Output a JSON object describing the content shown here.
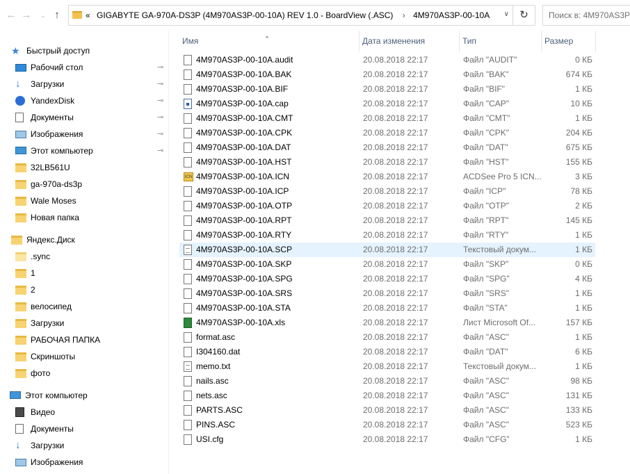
{
  "address": {
    "prefix": "«",
    "crumb1": "GIGABYTE GA-970A-DS3P (4M970AS3P-00-10A) REV 1.0 - BoardView (.ASC)",
    "crumb2": "4M970AS3P-00-10A",
    "search_placeholder": "Поиск в: 4M970AS3P-"
  },
  "nav": {
    "quick_access": "Быстрый доступ",
    "quick_items": [
      "Рабочий стол",
      "Загрузки",
      "YandexDisk",
      "Документы",
      "Изображения",
      "Этот компьютер",
      "32LB561U",
      "ga-970a-ds3p",
      "Wale Moses",
      "Новая папка"
    ],
    "yandex": "Яндекс.Диск",
    "yandex_items": [
      ".sync",
      "1",
      "2",
      "велосипед",
      "Загрузки",
      "РАБОЧАЯ ПАПКА",
      "Скриншоты",
      "фото"
    ],
    "this_pc": "Этот компьютер",
    "pc_items": [
      "Видео",
      "Документы",
      "Загрузки",
      "Изображения"
    ]
  },
  "columns": {
    "name": "Имя",
    "date": "Дата изменения",
    "type": "Тип",
    "size": "Размер"
  },
  "files": [
    {
      "name": "4M970AS3P-00-10A.audit",
      "date": "20.08.2018 22:17",
      "type": "Файл \"AUDIT\"",
      "size": "0 КБ",
      "icon": "file"
    },
    {
      "name": "4M970AS3P-00-10A.BAK",
      "date": "20.08.2018 22:17",
      "type": "Файл \"BAK\"",
      "size": "674 КБ",
      "icon": "file"
    },
    {
      "name": "4M970AS3P-00-10A.BIF",
      "date": "20.08.2018 22:17",
      "type": "Файл \"BIF\"",
      "size": "1 КБ",
      "icon": "file"
    },
    {
      "name": "4M970AS3P-00-10A.cap",
      "date": "20.08.2018 22:17",
      "type": "Файл \"CAP\"",
      "size": "10 КБ",
      "icon": "cap"
    },
    {
      "name": "4M970AS3P-00-10A.CMT",
      "date": "20.08.2018 22:17",
      "type": "Файл \"CMT\"",
      "size": "1 КБ",
      "icon": "file"
    },
    {
      "name": "4M970AS3P-00-10A.CPK",
      "date": "20.08.2018 22:17",
      "type": "Файл \"CPK\"",
      "size": "204 КБ",
      "icon": "file"
    },
    {
      "name": "4M970AS3P-00-10A.DAT",
      "date": "20.08.2018 22:17",
      "type": "Файл \"DAT\"",
      "size": "675 КБ",
      "icon": "file"
    },
    {
      "name": "4M970AS3P-00-10A.HST",
      "date": "20.08.2018 22:17",
      "type": "Файл \"HST\"",
      "size": "155 КБ",
      "icon": "file"
    },
    {
      "name": "4M970AS3P-00-10A.ICN",
      "date": "20.08.2018 22:17",
      "type": "ACDSee Pro 5 ICN...",
      "size": "3 КБ",
      "icon": "icn"
    },
    {
      "name": "4M970AS3P-00-10A.ICP",
      "date": "20.08.2018 22:17",
      "type": "Файл \"ICP\"",
      "size": "78 КБ",
      "icon": "file"
    },
    {
      "name": "4M970AS3P-00-10A.OTP",
      "date": "20.08.2018 22:17",
      "type": "Файл \"OTP\"",
      "size": "2 КБ",
      "icon": "file"
    },
    {
      "name": "4M970AS3P-00-10A.RPT",
      "date": "20.08.2018 22:17",
      "type": "Файл \"RPT\"",
      "size": "145 КБ",
      "icon": "file"
    },
    {
      "name": "4M970AS3P-00-10A.RTY",
      "date": "20.08.2018 22:17",
      "type": "Файл \"RTY\"",
      "size": "1 КБ",
      "icon": "file"
    },
    {
      "name": "4M970AS3P-00-10A.SCP",
      "date": "20.08.2018 22:17",
      "type": "Текстовый докум...",
      "size": "1 КБ",
      "icon": "txt",
      "selected": true
    },
    {
      "name": "4M970AS3P-00-10A.SKP",
      "date": "20.08.2018 22:17",
      "type": "Файл \"SKP\"",
      "size": "0 КБ",
      "icon": "file"
    },
    {
      "name": "4M970AS3P-00-10A.SPG",
      "date": "20.08.2018 22:17",
      "type": "Файл \"SPG\"",
      "size": "4 КБ",
      "icon": "file"
    },
    {
      "name": "4M970AS3P-00-10A.SRS",
      "date": "20.08.2018 22:17",
      "type": "Файл \"SRS\"",
      "size": "1 КБ",
      "icon": "file"
    },
    {
      "name": "4M970AS3P-00-10A.STA",
      "date": "20.08.2018 22:17",
      "type": "Файл \"STA\"",
      "size": "1 КБ",
      "icon": "file"
    },
    {
      "name": "4M970AS3P-00-10A.xls",
      "date": "20.08.2018 22:17",
      "type": "Лист Microsoft Of...",
      "size": "157 КБ",
      "icon": "xls"
    },
    {
      "name": "format.asc",
      "date": "20.08.2018 22:17",
      "type": "Файл \"ASC\"",
      "size": "1 КБ",
      "icon": "file"
    },
    {
      "name": "I304160.dat",
      "date": "20.08.2018 22:17",
      "type": "Файл \"DAT\"",
      "size": "6 КБ",
      "icon": "file"
    },
    {
      "name": "memo.txt",
      "date": "20.08.2018 22:17",
      "type": "Текстовый докум...",
      "size": "1 КБ",
      "icon": "txt"
    },
    {
      "name": "nails.asc",
      "date": "20.08.2018 22:17",
      "type": "Файл \"ASC\"",
      "size": "98 КБ",
      "icon": "file"
    },
    {
      "name": "nets.asc",
      "date": "20.08.2018 22:17",
      "type": "Файл \"ASC\"",
      "size": "131 КБ",
      "icon": "file"
    },
    {
      "name": "PARTS.ASC",
      "date": "20.08.2018 22:17",
      "type": "Файл \"ASC\"",
      "size": "133 КБ",
      "icon": "file"
    },
    {
      "name": "PINS.ASC",
      "date": "20.08.2018 22:17",
      "type": "Файл \"ASC\"",
      "size": "523 КБ",
      "icon": "file"
    },
    {
      "name": "USI.cfg",
      "date": "20.08.2018 22:17",
      "type": "Файл \"CFG\"",
      "size": "1 КБ",
      "icon": "file"
    }
  ]
}
